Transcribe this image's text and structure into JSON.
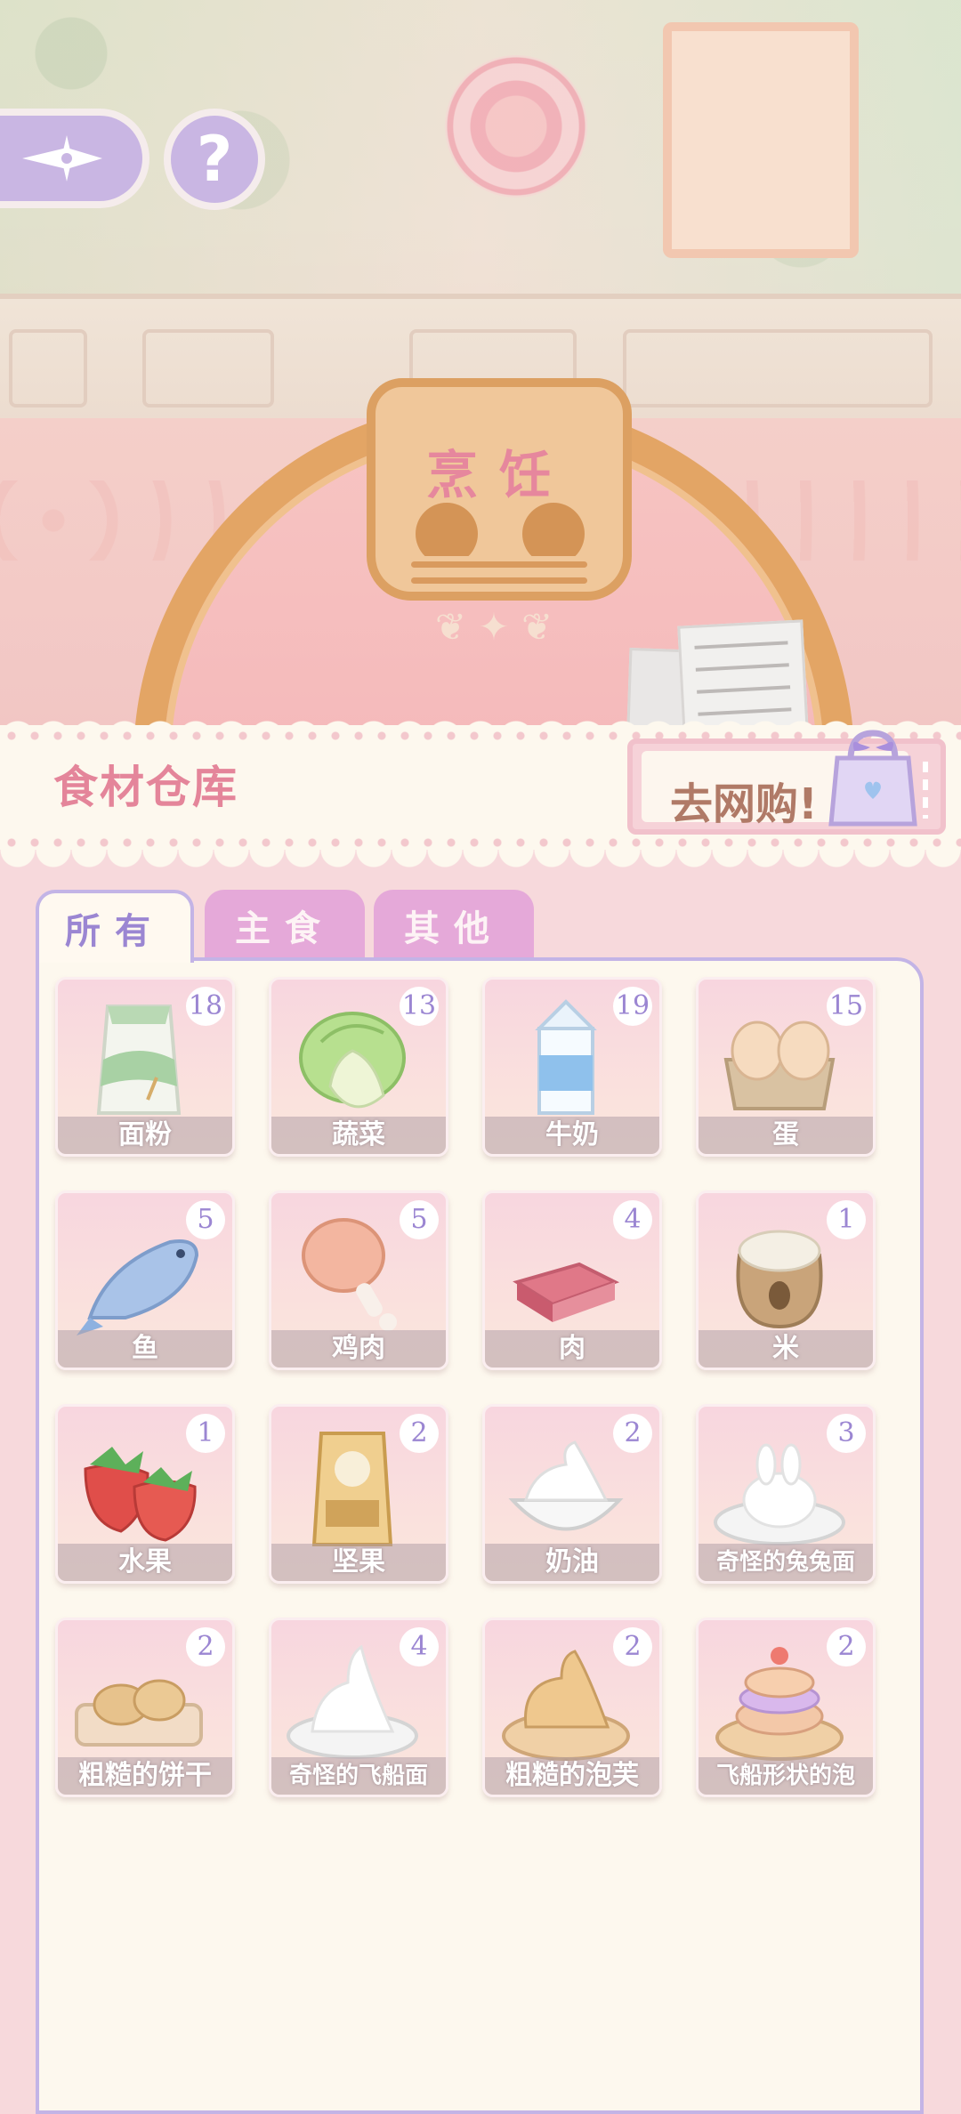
{
  "plaque_title": "烹饪",
  "header": {
    "title": "食材仓库",
    "shop_label": "去网购!"
  },
  "tabs": [
    {
      "label": "所有",
      "active": true
    },
    {
      "label": "主食",
      "active": false
    },
    {
      "label": "其他",
      "active": false
    }
  ],
  "help_label": "?",
  "colors": {
    "accent_purple": "#c9b6e3",
    "title_pink": "#e4859a",
    "count_purple": "#9b86d2",
    "tab_inactive": "#e5a9d9",
    "panel_border": "#c3b4e6"
  },
  "items": [
    {
      "name": "面粉",
      "count": "18",
      "icon": "flour-icon"
    },
    {
      "name": "蔬菜",
      "count": "13",
      "icon": "cabbage-icon"
    },
    {
      "name": "牛奶",
      "count": "19",
      "icon": "milk-carton-icon"
    },
    {
      "name": "蛋",
      "count": "15",
      "icon": "eggs-icon"
    },
    {
      "name": "鱼",
      "count": "5",
      "icon": "fish-icon"
    },
    {
      "name": "鸡肉",
      "count": "5",
      "icon": "chicken-leg-icon"
    },
    {
      "name": "肉",
      "count": "4",
      "icon": "meat-icon"
    },
    {
      "name": "米",
      "count": "1",
      "icon": "rice-sack-icon"
    },
    {
      "name": "水果",
      "count": "1",
      "icon": "strawberry-icon"
    },
    {
      "name": "坚果",
      "count": "2",
      "icon": "nuts-bag-icon"
    },
    {
      "name": "奶油",
      "count": "2",
      "icon": "cream-bowl-icon"
    },
    {
      "name": "奇怪的兔兔面",
      "count": "3",
      "icon": "bunny-bread-icon"
    },
    {
      "name": "粗糙的饼干",
      "count": "2",
      "icon": "cookies-icon"
    },
    {
      "name": "奇怪的飞船面",
      "count": "4",
      "icon": "ship-bread-icon"
    },
    {
      "name": "粗糙的泡芙",
      "count": "2",
      "icon": "puff-icon"
    },
    {
      "name": "飞船形状的泡",
      "count": "2",
      "icon": "cake-puff-icon"
    }
  ]
}
